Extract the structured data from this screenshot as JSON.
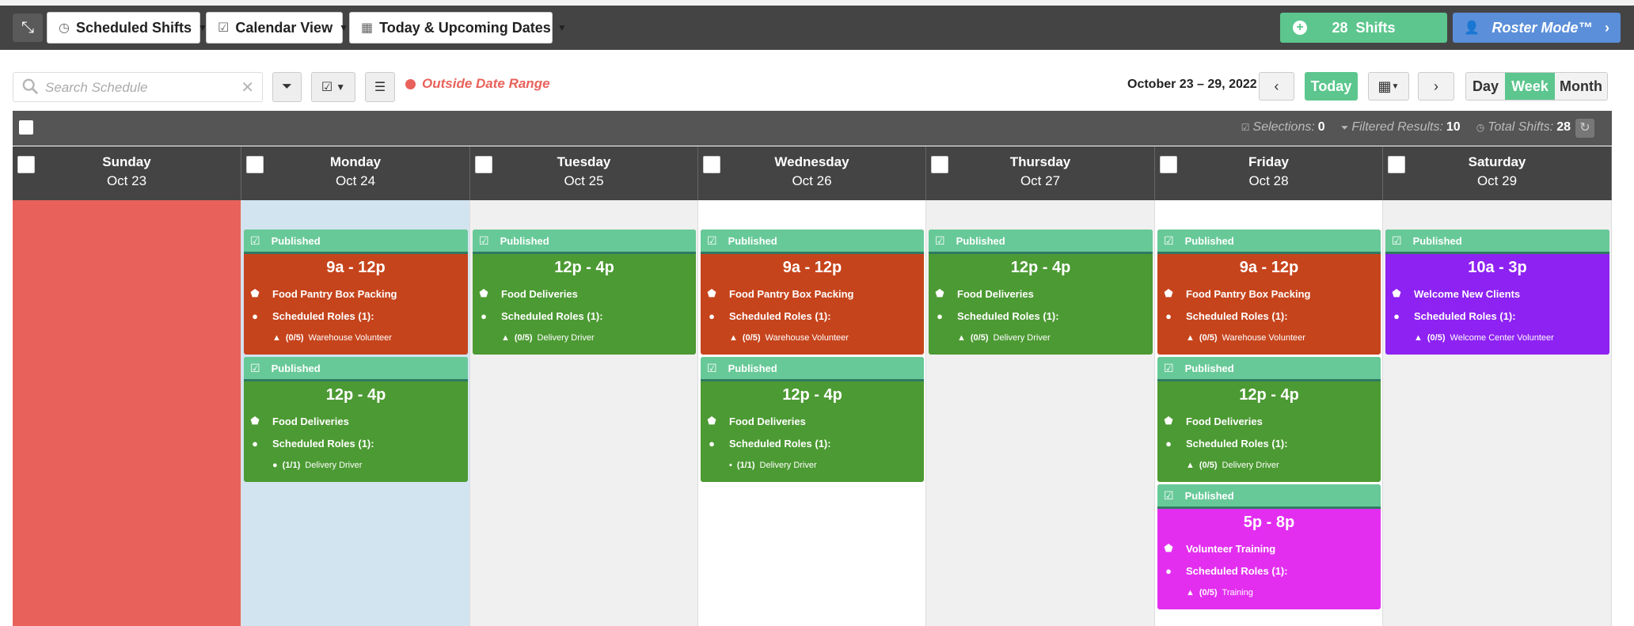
{
  "toolbar": {
    "scheduled_shifts": "Scheduled Shifts",
    "calendar_view": "Calendar View",
    "date_filter": "Today & Upcoming Dates",
    "shift_count": "28",
    "shifts_label": "Shifts",
    "roster_mode": "Roster Mode™"
  },
  "controls": {
    "search_placeholder": "Search Schedule",
    "outside_range": "Outside Date Range",
    "date_range": "October 23 – 29, 2022",
    "today": "Today",
    "views": [
      "Day",
      "Week",
      "Month"
    ],
    "active_view": "Week"
  },
  "status": {
    "selections_label": "Selections:",
    "selections": "0",
    "filtered_label": "Filtered Results:",
    "filtered": "10",
    "total_label": "Total Shifts:",
    "total": "28"
  },
  "days": [
    {
      "name": "Sunday",
      "date": "Oct 23"
    },
    {
      "name": "Monday",
      "date": "Oct 24"
    },
    {
      "name": "Tuesday",
      "date": "Oct 25"
    },
    {
      "name": "Wednesday",
      "date": "Oct 26"
    },
    {
      "name": "Thursday",
      "date": "Oct 27"
    },
    {
      "name": "Friday",
      "date": "Oct 28"
    },
    {
      "name": "Saturday",
      "date": "Oct 29"
    }
  ],
  "shifts": [
    {
      "day": 1,
      "slot": 0,
      "status": "Published",
      "time": "9a - 12p",
      "name": "Food Pantry Box Packing",
      "roles_label": "Scheduled Roles (1):",
      "role_count": "(0/5)",
      "role": "Warehouse Volunteer",
      "role_icon": "warning-icon",
      "color": "#c6441c"
    },
    {
      "day": 1,
      "slot": 1,
      "status": "Published",
      "time": "12p - 4p",
      "name": "Food Deliveries",
      "roles_label": "Scheduled Roles (1):",
      "role_count": "(1/1)",
      "role": "Delivery Driver",
      "role_icon": "check-circle-icon",
      "color": "#4c9a33"
    },
    {
      "day": 2,
      "slot": 0,
      "status": "Published",
      "time": "12p - 4p",
      "name": "Food Deliveries",
      "roles_label": "Scheduled Roles (1):",
      "role_count": "(0/5)",
      "role": "Delivery Driver",
      "role_icon": "warning-icon",
      "color": "#4c9a33"
    },
    {
      "day": 3,
      "slot": 0,
      "status": "Published",
      "time": "9a - 12p",
      "name": "Food Pantry Box Packing",
      "roles_label": "Scheduled Roles (1):",
      "role_count": "(0/5)",
      "role": "Warehouse Volunteer",
      "role_icon": "warning-icon",
      "color": "#c6441c"
    },
    {
      "day": 3,
      "slot": 1,
      "status": "Published",
      "time": "12p - 4p",
      "name": "Food Deliveries",
      "roles_label": "Scheduled Roles (1):",
      "role_count": "(1/1)",
      "role": "Delivery Driver",
      "role_icon": "lock-icon",
      "color": "#4c9a33"
    },
    {
      "day": 4,
      "slot": 0,
      "status": "Published",
      "time": "12p - 4p",
      "name": "Food Deliveries",
      "roles_label": "Scheduled Roles (1):",
      "role_count": "(0/5)",
      "role": "Delivery Driver",
      "role_icon": "warning-icon",
      "color": "#4c9a33"
    },
    {
      "day": 5,
      "slot": 0,
      "status": "Published",
      "time": "9a - 12p",
      "name": "Food Pantry Box Packing",
      "roles_label": "Scheduled Roles (1):",
      "role_count": "(0/5)",
      "role": "Warehouse Volunteer",
      "role_icon": "warning-icon",
      "color": "#c6441c"
    },
    {
      "day": 5,
      "slot": 1,
      "status": "Published",
      "time": "12p - 4p",
      "name": "Food Deliveries",
      "roles_label": "Scheduled Roles (1):",
      "role_count": "(0/5)",
      "role": "Delivery Driver",
      "role_icon": "warning-icon",
      "color": "#4c9a33"
    },
    {
      "day": 5,
      "slot": 2,
      "status": "Published",
      "time": "5p - 8p",
      "name": "Volunteer Training",
      "roles_label": "Scheduled Roles (1):",
      "role_count": "(0/5)",
      "role": "Training",
      "role_icon": "warning-icon",
      "color": "#e32ef0"
    },
    {
      "day": 6,
      "slot": 0,
      "status": "Published",
      "time": "10a - 3p",
      "name": "Welcome New Clients",
      "roles_label": "Scheduled Roles (1):",
      "role_count": "(0/5)",
      "role": "Welcome Center Volunteer",
      "role_icon": "warning-icon",
      "color": "#8e22f2"
    }
  ],
  "colors": {
    "outside_range": "#e8625b",
    "today_column": "#d3e4f1",
    "alt_column": "#f0f0f0",
    "accent_green": "#5cc68e",
    "accent_blue": "#5b8fd9"
  }
}
